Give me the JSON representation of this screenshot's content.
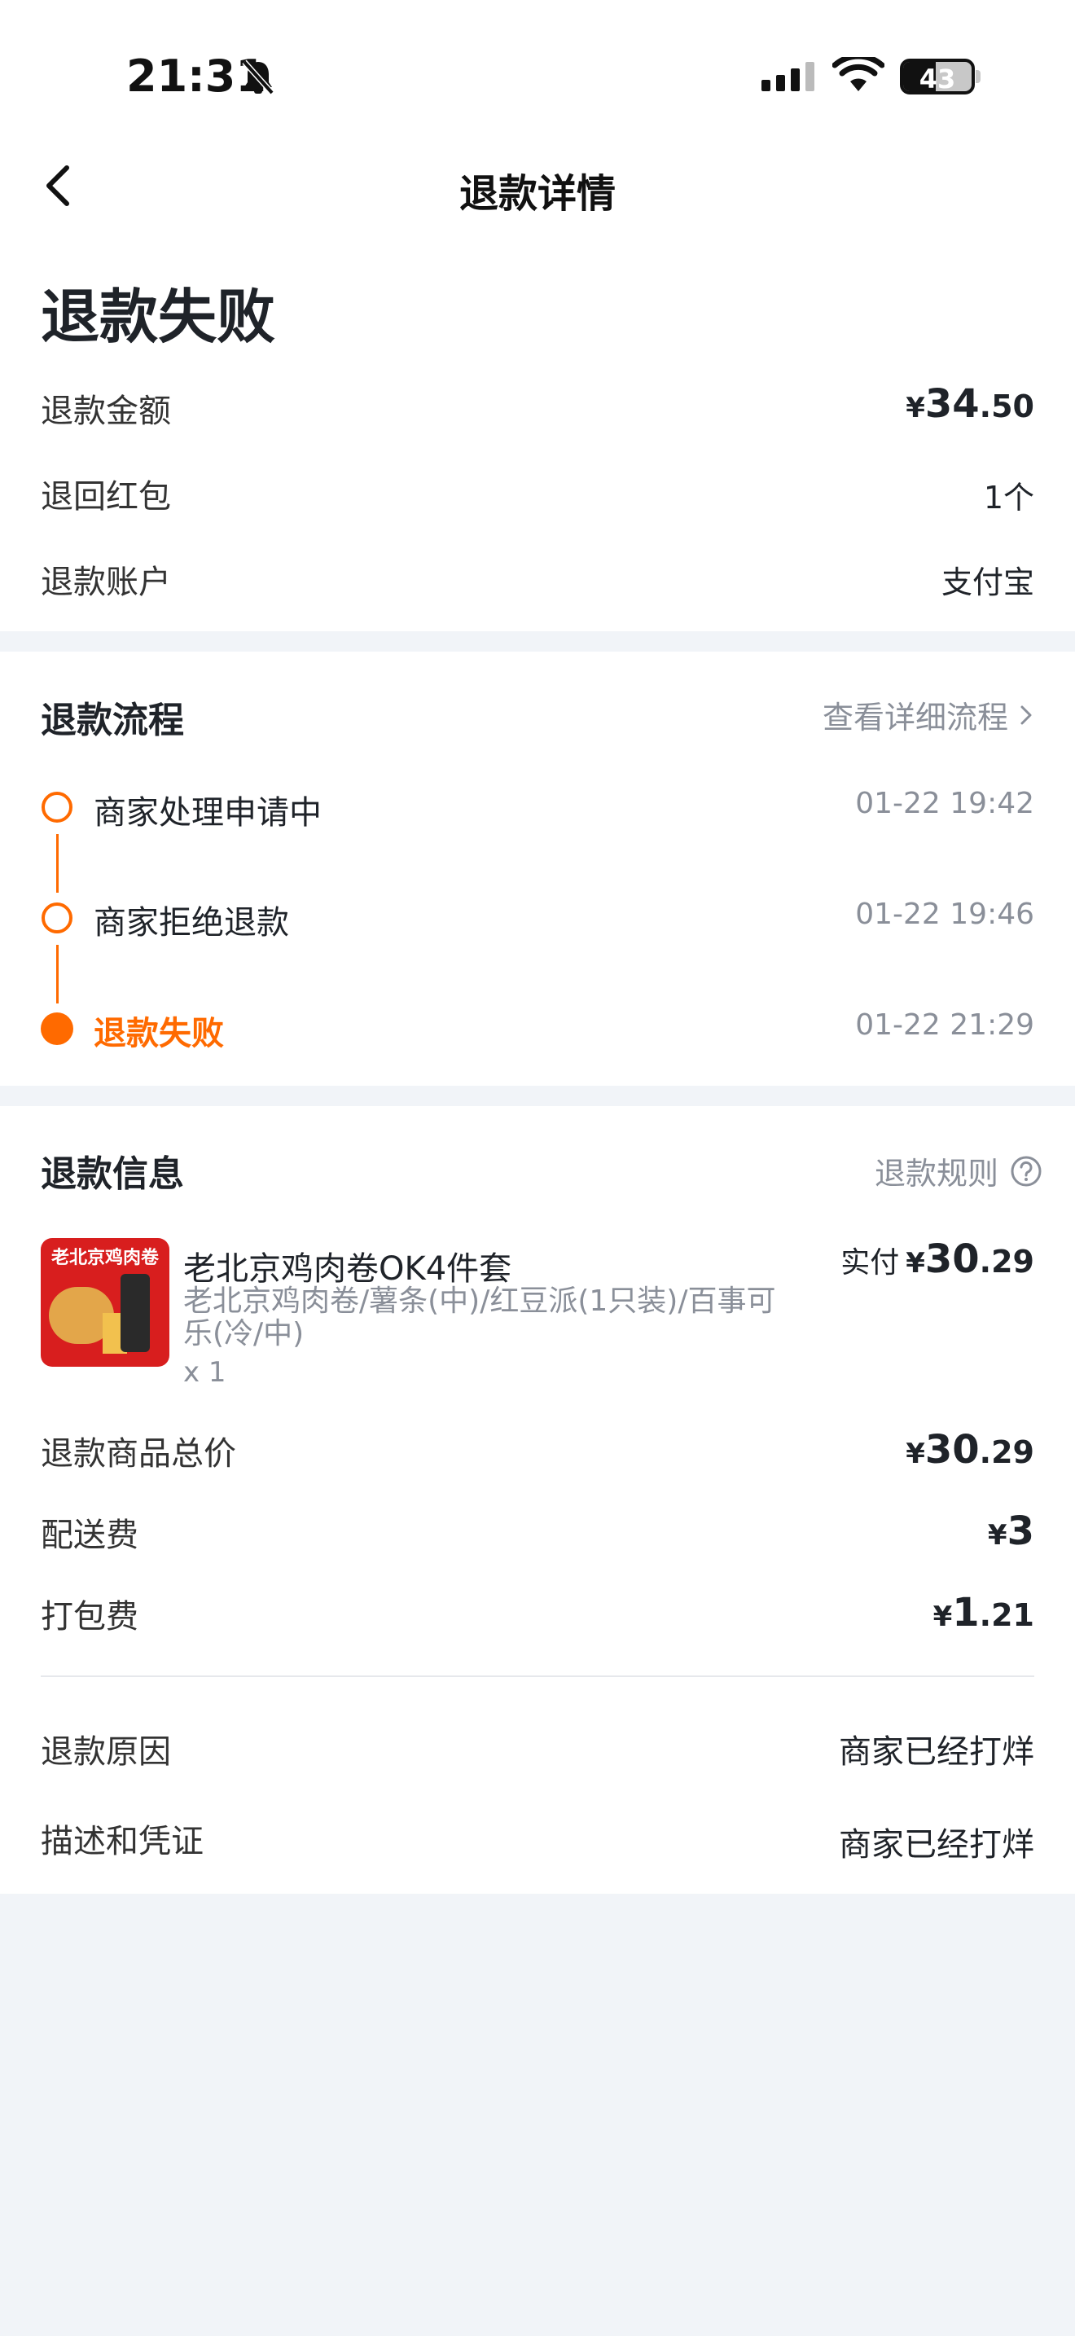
{
  "status_bar": {
    "time": "21:31",
    "battery": "43"
  },
  "nav": {
    "title": "退款详情"
  },
  "refund_status": {
    "title": "退款失败",
    "rows": [
      {
        "label": "退款金额",
        "currency": "¥",
        "int": "34",
        "dec": ".50"
      },
      {
        "label": "退回红包",
        "value": "1个"
      },
      {
        "label": "退款账户",
        "value": "支付宝"
      }
    ]
  },
  "process": {
    "title": "退款流程",
    "link": "查看详细流程",
    "steps": [
      {
        "label": "商家处理申请中",
        "time": "01-22 19:42"
      },
      {
        "label": "商家拒绝退款",
        "time": "01-22 19:46"
      },
      {
        "label": "退款失败",
        "time": "01-22 21:29"
      }
    ]
  },
  "info": {
    "title": "退款信息",
    "rules_link": "退款规则",
    "product": {
      "image_text": "老北京鸡肉卷",
      "name": "老北京鸡肉卷OK4件套",
      "desc": "老北京鸡肉卷/薯条(中)/红豆派(1只装)/百事可乐(冷/中)",
      "qty": "x 1",
      "paid_label": "实付",
      "currency": "¥",
      "int": "30",
      "dec": ".29"
    },
    "fees": [
      {
        "label": "退款商品总价",
        "currency": "¥",
        "int": "30",
        "dec": ".29"
      },
      {
        "label": "配送费",
        "currency": "¥",
        "int": "3",
        "dec": ""
      },
      {
        "label": "打包费",
        "currency": "¥",
        "int": "1",
        "dec": ".21"
      }
    ],
    "reason_label": "退款原因",
    "reason_value": "商家已经打烊",
    "evidence_label": "描述和凭证",
    "evidence_value": "商家已经打烊"
  },
  "colors": {
    "accent": "#ff6a00",
    "background": "#f1f4f8",
    "card": "#ffffff",
    "muted": "#8a8f99"
  }
}
